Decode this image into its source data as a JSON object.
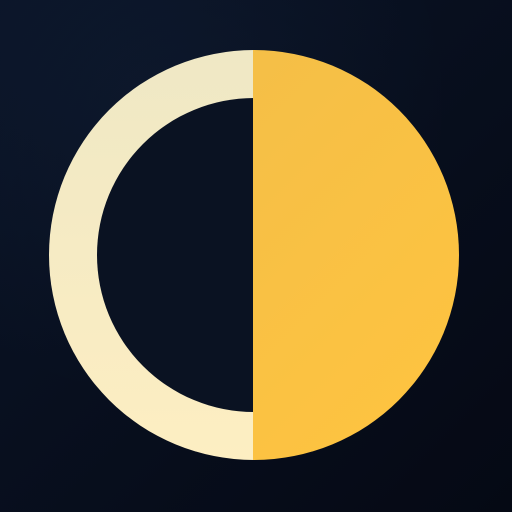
{
  "app_icon": {
    "name": "half-moon-theme-toggle-icon",
    "shape": "circle split vertically: left half outline ring, right half filled disc",
    "colors": {
      "background_top": "#0a1427",
      "background_bottom": "#050914",
      "ring_top": "#efe8c5",
      "ring_bottom": "#fdeec2",
      "fill_top": "#f1bd4a",
      "fill_bottom": "#ffc43f",
      "inner_dark": "#0a1222"
    }
  }
}
